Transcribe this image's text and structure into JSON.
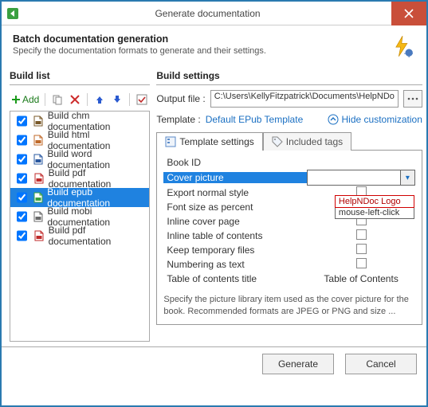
{
  "window": {
    "title": "Generate documentation"
  },
  "intro": {
    "heading": "Batch documentation generation",
    "subtext": "Specify the documentation formats to generate and their settings."
  },
  "build_list": {
    "title": "Build list",
    "add_label": "Add",
    "items": [
      {
        "label": "Build chm documentation",
        "checked": true,
        "color": "#7a5a2a",
        "selected": false
      },
      {
        "label": "Build html documentation",
        "checked": true,
        "color": "#c06a2a",
        "selected": false
      },
      {
        "label": "Build word documentation",
        "checked": true,
        "color": "#2a58a0",
        "selected": false
      },
      {
        "label": "Build pdf documentation",
        "checked": true,
        "color": "#c02a2a",
        "selected": false
      },
      {
        "label": "Build epub documentation",
        "checked": true,
        "color": "#3aa040",
        "selected": true
      },
      {
        "label": "Build mobi documentation",
        "checked": true,
        "color": "#6a6a6a",
        "selected": false
      },
      {
        "label": "Build pdf documentation",
        "checked": true,
        "color": "#c02a2a",
        "selected": false
      }
    ]
  },
  "build_settings": {
    "title": "Build settings",
    "output_label": "Output file :",
    "output_path": "C:\\Users\\KellyFitzpatrick\\Documents\\HelpNDo",
    "template_label": "Template :",
    "template_value": "Default EPub Template",
    "hide_customization": "Hide customization",
    "tabs": {
      "template": "Template settings",
      "included": "Included tags"
    },
    "rows": [
      {
        "name": "Book ID",
        "value": "",
        "type": "text"
      },
      {
        "name": "Cover picture",
        "value": "",
        "type": "dropdown",
        "selected": true
      },
      {
        "name": "Export normal style",
        "value": "",
        "type": "check"
      },
      {
        "name": "Font size as percent",
        "value": "",
        "type": "check"
      },
      {
        "name": "Inline cover page",
        "value": "",
        "type": "check"
      },
      {
        "name": "Inline table of contents",
        "value": "",
        "type": "check"
      },
      {
        "name": "Keep temporary files",
        "value": "",
        "type": "check"
      },
      {
        "name": "Numbering as text",
        "value": "",
        "type": "check"
      },
      {
        "name": "Table of contents title",
        "value": "Table of Contents",
        "type": "text"
      }
    ],
    "dropdown_options": [
      {
        "label": "HelpNDoc Logo",
        "highlighted": true
      },
      {
        "label": "mouse-left-click",
        "highlighted": false
      }
    ],
    "hint": "Specify the picture library item used as the cover picture for the book. Recommended formats are JPEG or PNG and size ..."
  },
  "footer": {
    "generate": "Generate",
    "cancel": "Cancel"
  }
}
